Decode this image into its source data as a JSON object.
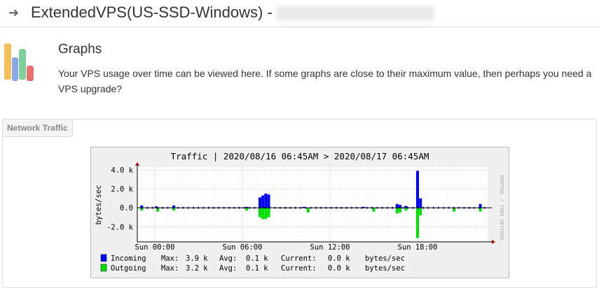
{
  "header": {
    "title": "ExtendedVPS(US-SSD-Windows) -"
  },
  "section": {
    "title": "Graphs",
    "description": "Your VPS usage over time can be viewed here. If some graphs are close to their maximum value, then perhaps you need a VPS upgrade?"
  },
  "panel": {
    "tab": "Network Traffic"
  },
  "chart_data": {
    "type": "bar",
    "title": "Traffic | 2020/08/16 06:45AM > 2020/08/17 06:45AM",
    "ylabel": "bytes/sec",
    "side_label": "RRDTOOL / TOBI OETIKER",
    "ylim": [
      -3.6,
      4.3
    ],
    "yticks": [
      {
        "v": 4,
        "label": "4.0 k"
      },
      {
        "v": 2,
        "label": "2.0 k"
      },
      {
        "v": 0,
        "label": "0.0"
      },
      {
        "v": -2,
        "label": "-2.0 k"
      }
    ],
    "xlim": [
      -1.2,
      22.8
    ],
    "xticks": [
      {
        "v": 0,
        "label": "Sun 00:00"
      },
      {
        "v": 6,
        "label": "Sun 06:00"
      },
      {
        "v": 12,
        "label": "Sun 12:00"
      },
      {
        "v": 18,
        "label": "Sun 18:00"
      }
    ],
    "series": [
      {
        "name": "Incoming",
        "color": "#0000ff",
        "points": [
          [
            -0.9,
            0.25
          ],
          [
            0.1,
            0.15
          ],
          [
            1.3,
            0.25
          ],
          [
            6.3,
            0.1
          ],
          [
            7.2,
            1.1
          ],
          [
            7.4,
            1.3
          ],
          [
            7.6,
            1.5
          ],
          [
            7.8,
            1.4
          ],
          [
            10.2,
            0.1
          ],
          [
            14.3,
            0.1
          ],
          [
            16.6,
            0.4
          ],
          [
            16.8,
            0.3
          ],
          [
            17.2,
            0.2
          ],
          [
            18.0,
            3.9
          ],
          [
            18.2,
            1.0
          ],
          [
            22.3,
            0.4
          ]
        ]
      },
      {
        "name": "Outgoing",
        "color": "#00e000",
        "points": [
          [
            -0.9,
            -0.3
          ],
          [
            0.2,
            -0.4
          ],
          [
            1.3,
            -0.3
          ],
          [
            6.3,
            -0.3
          ],
          [
            7.2,
            -1.0
          ],
          [
            7.4,
            -1.2
          ],
          [
            7.6,
            -1.2
          ],
          [
            7.8,
            -1.0
          ],
          [
            10.5,
            -0.5
          ],
          [
            15.0,
            -0.4
          ],
          [
            16.6,
            -0.6
          ],
          [
            16.8,
            -0.5
          ],
          [
            17.2,
            -0.3
          ],
          [
            18.0,
            -3.2
          ],
          [
            18.2,
            -0.8
          ],
          [
            20.5,
            -0.4
          ],
          [
            22.3,
            -0.4
          ]
        ]
      }
    ],
    "legend": [
      {
        "name": "Incoming",
        "max": "3.9 k",
        "avg": "0.1 k",
        "current": "0.0 k",
        "unit": "bytes/sec"
      },
      {
        "name": "Outgoing",
        "max": "3.2 k",
        "avg": "0.1 k",
        "current": "0.0 k",
        "unit": "bytes/sec"
      }
    ],
    "legend_labels": {
      "max": "Max:",
      "avg": "Avg:",
      "current": "Current:"
    }
  }
}
